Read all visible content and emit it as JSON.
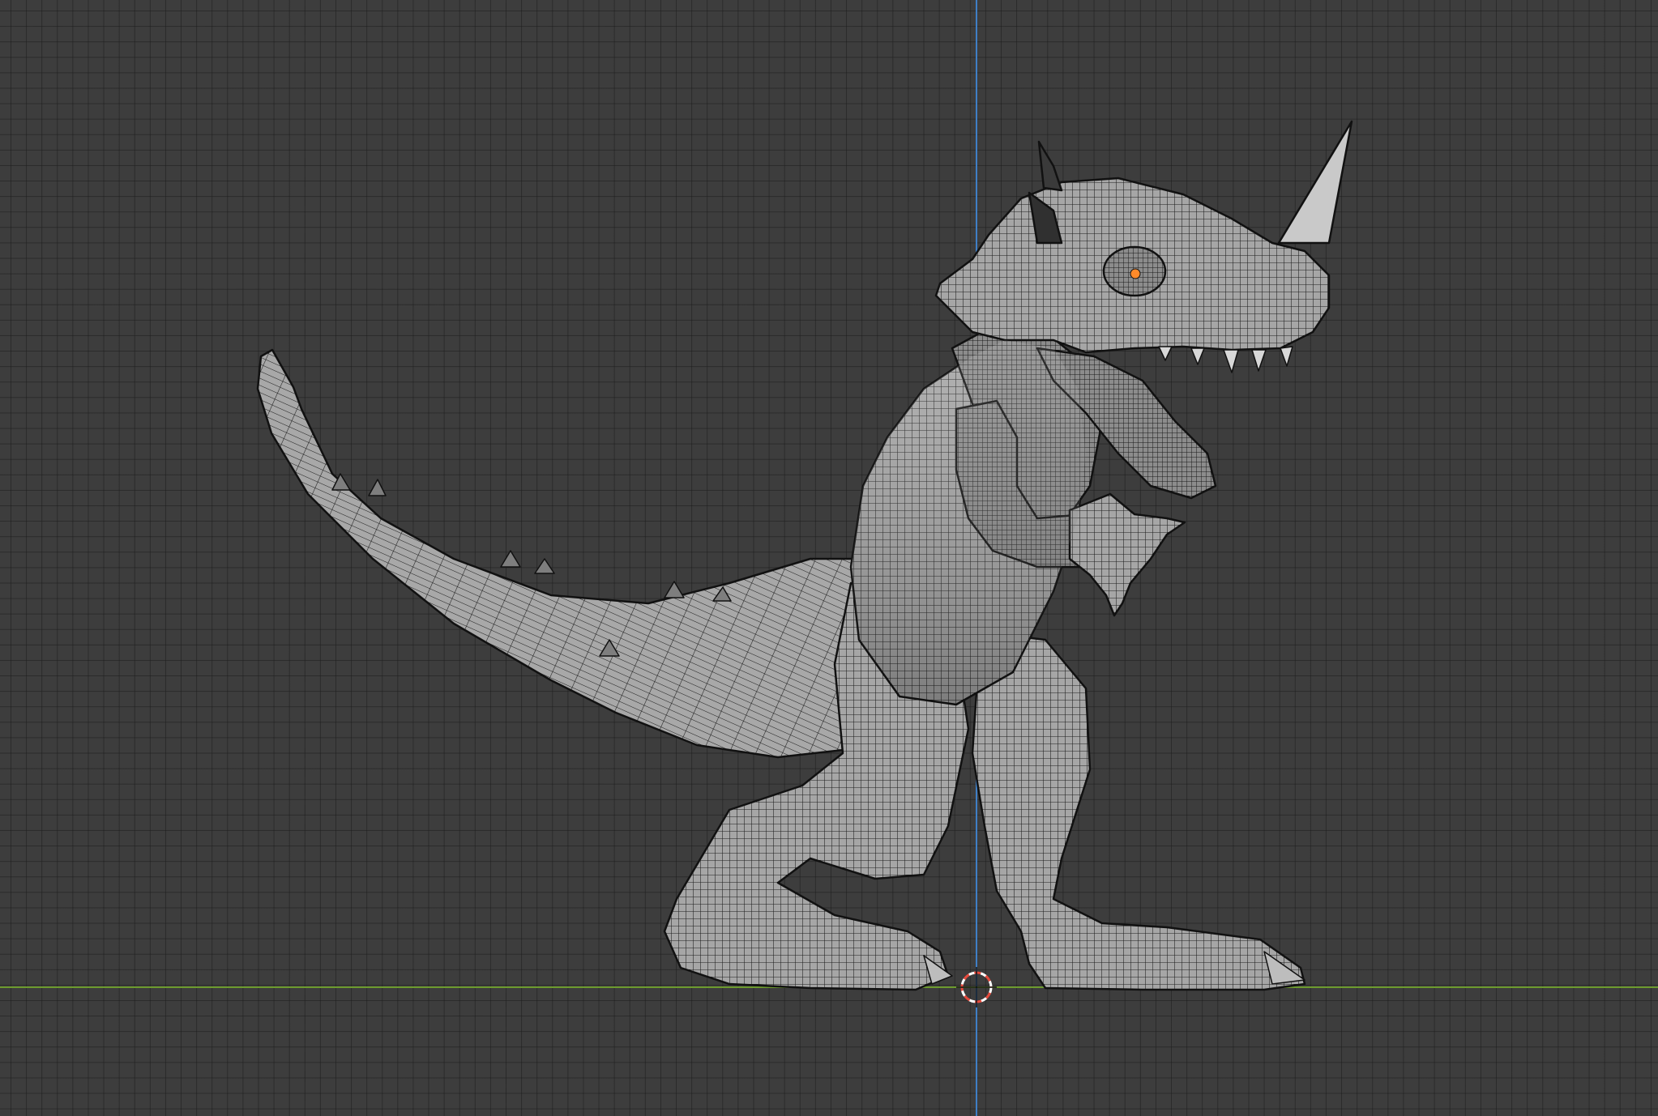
{
  "app": {
    "view": "3d-viewport",
    "shading": "solid-wireframe-overlay",
    "view_orientation": "side"
  },
  "viewport": {
    "background_color": "#3d3d3d",
    "grid_line_color": "#2a2a2a",
    "x_axis_color": "#6c9a2e",
    "z_axis_color": "#3f7fc6",
    "cursor_colors": [
      "#e64a3c",
      "#ffffff"
    ]
  },
  "object": {
    "icon": "dinosaur-mesh-icon",
    "surface_color": "#a9a9a9",
    "wire_color": "#1b1b1b",
    "eye_color": "#ff8a2a"
  }
}
